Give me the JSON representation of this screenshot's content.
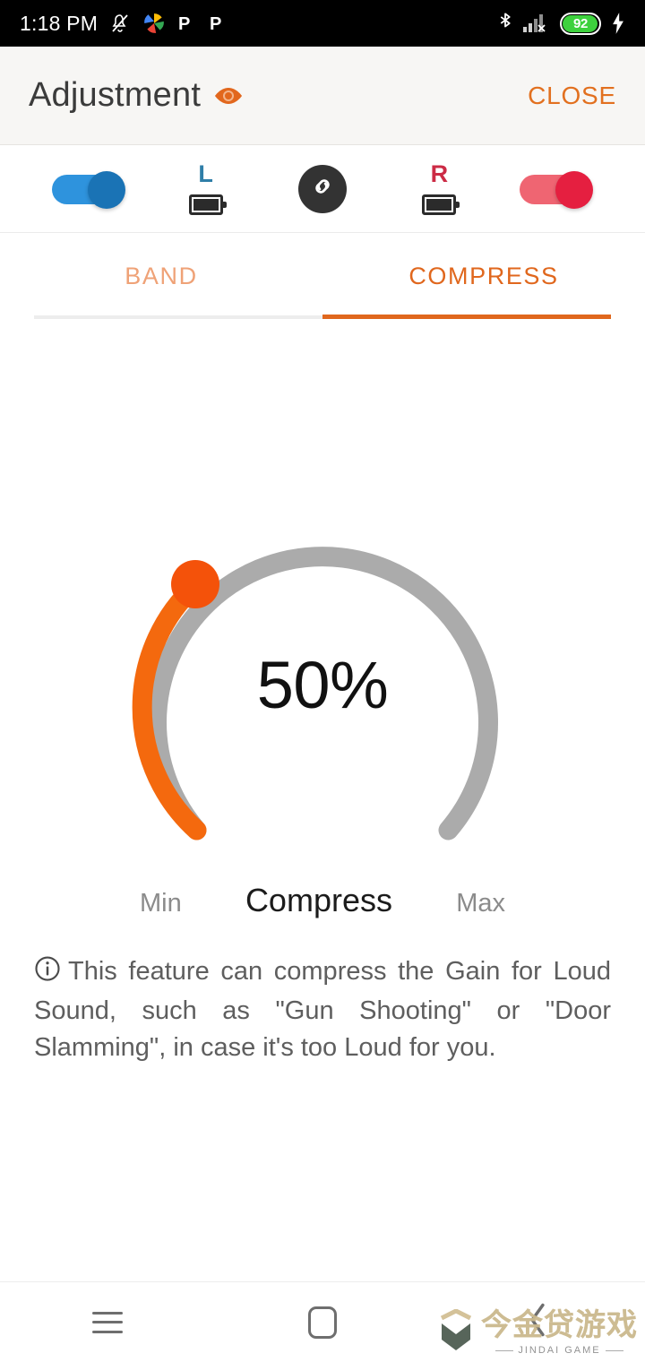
{
  "status_bar": {
    "time": "1:18 PM",
    "battery_level": "92",
    "icons": [
      "notifications-off-icon",
      "photos-icon",
      "p-app-icon",
      "p-app-icon",
      "bluetooth-icon",
      "signal-no-sim-icon",
      "battery-icon",
      "charging-bolt-icon"
    ]
  },
  "header": {
    "title": "Adjustment",
    "eye_icon": "eye-icon",
    "close_label": "CLOSE"
  },
  "device_bar": {
    "left_toggle": {
      "name": "left-device-toggle",
      "state": "on",
      "color": "#2e93dd"
    },
    "left_side": {
      "label": "L",
      "color": "#2f7ea8",
      "battery_icon": "battery-full-icon"
    },
    "link_button": {
      "name": "link-devices-button",
      "icon": "chain-link-icon"
    },
    "right_side": {
      "label": "R",
      "color": "#cc2b45",
      "battery_icon": "battery-full-icon"
    },
    "right_toggle": {
      "name": "right-device-toggle",
      "state": "on",
      "color": "#e51f40"
    }
  },
  "tabs": [
    {
      "label": "BAND",
      "active": false
    },
    {
      "label": "COMPRESS",
      "active": true
    }
  ],
  "gauge": {
    "value_text": "50%",
    "value": 50,
    "min_label": "Min",
    "max_label": "Max",
    "title": "Compress",
    "track_color": "#ababab",
    "fill_color": "#f4690e",
    "knob_color": "#f4520a"
  },
  "description": {
    "info_icon": "info-icon",
    "text": "This feature can compress the Gain for Loud Sound, such as \"Gun Shooting\" or \"Door Slamming\", in case it's too Loud for you."
  },
  "nav_bar": {
    "recents_label": "recents-button",
    "home_label": "home-button",
    "back_label": "back-button"
  },
  "watermark": {
    "cn_text": "今金贷游戏",
    "en_text": "JINDAI GAME"
  }
}
